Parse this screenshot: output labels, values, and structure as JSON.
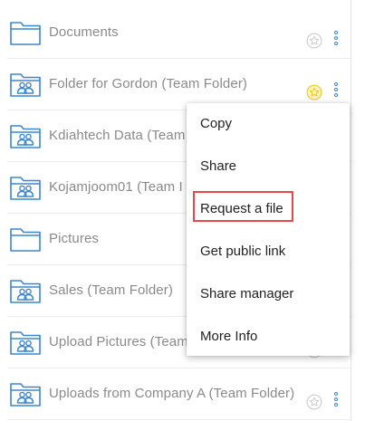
{
  "file_list": {
    "rows": [
      {
        "name": "Documents",
        "type": "folder",
        "starred": false
      },
      {
        "name": "Folder for Gordon (Team Folder)",
        "type": "team-folder",
        "starred": true
      },
      {
        "name": "Kdiahtech Data (Team",
        "type": "team-folder",
        "starred": false
      },
      {
        "name": "Kojamjoom01 (Team I",
        "type": "team-folder",
        "starred": false
      },
      {
        "name": "Pictures",
        "type": "folder",
        "starred": false
      },
      {
        "name": "Sales (Team Folder)",
        "type": "team-folder",
        "starred": false
      },
      {
        "name": "Upload Pictures (Team",
        "type": "team-folder",
        "starred": false
      },
      {
        "name": "Uploads from Company A (Team Folder)",
        "type": "team-folder",
        "starred": false
      }
    ]
  },
  "context_menu": {
    "items": [
      {
        "label": "Copy"
      },
      {
        "label": "Share"
      },
      {
        "label": "Request a file",
        "highlighted": true
      },
      {
        "label": "Get public link"
      },
      {
        "label": "Share manager"
      },
      {
        "label": "More Info"
      }
    ]
  },
  "colors": {
    "accent_blue": "#3f86c9",
    "star_gold": "#f0c419",
    "star_gray": "#c8c8c8",
    "highlight_red": "#e44a4a",
    "row_text": "#8a8a8a"
  },
  "icons": {
    "folder": "folder-icon",
    "team_folder": "team-folder-icon",
    "star": "star-icon",
    "more": "kebab-menu-icon"
  }
}
